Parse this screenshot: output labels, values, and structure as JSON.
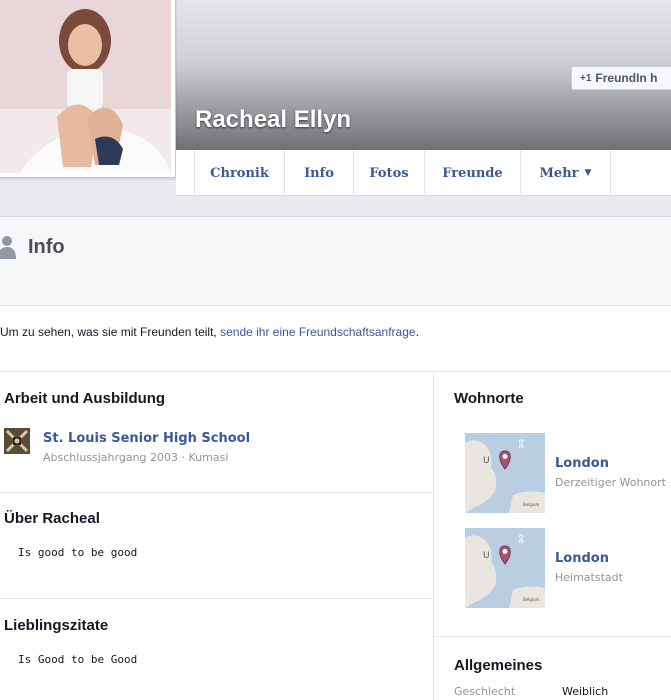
{
  "header": {
    "name": "Racheal Ellyn",
    "add_friend_label": "FreundIn h",
    "add_friend_icon": "add-friend-icon"
  },
  "nav": {
    "items": [
      "Chronik",
      "Info",
      "Fotos",
      "Freunde",
      "Mehr"
    ],
    "more_icon": "caret-down-icon"
  },
  "info": {
    "title": "Info",
    "notice_prefix": "Um zu sehen, was sie mit Freunden teilt,",
    "notice_link": "sende ihr eine Freundschaftsanfrage",
    "notice_suffix": "."
  },
  "work": {
    "title": "Arbeit und Ausbildung",
    "school_name": "St. Louis Senior High School",
    "school_detail": "Abschlussjahrgang 2003 · Kumasi"
  },
  "about": {
    "title": "Über Racheal",
    "text": "Is good to be good"
  },
  "quotes": {
    "title": "Lieblingszitate",
    "text": "Is Good to be Good"
  },
  "places": {
    "title": "Wohnorte",
    "items": [
      {
        "name": "London",
        "type": "Derzeitiger Wohnort"
      },
      {
        "name": "London",
        "type": "Heimatstadt"
      }
    ]
  },
  "general": {
    "title": "Allgemeines",
    "gender_label": "Geschlecht",
    "gender_value": "Weiblich"
  },
  "colors": {
    "link": "#3b5998",
    "muted": "#90949c",
    "page_bg": "#e9eaed"
  }
}
